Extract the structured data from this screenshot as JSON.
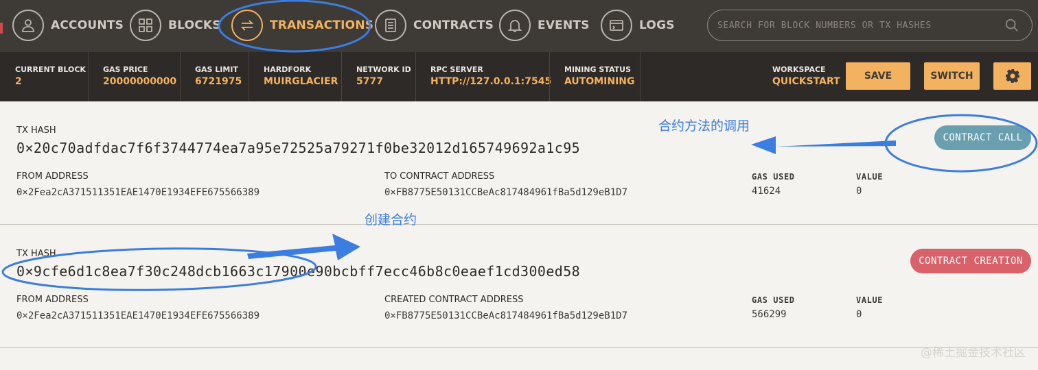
{
  "nav": {
    "items": [
      {
        "label": "ACCOUNTS",
        "icon": "user-icon"
      },
      {
        "label": "BLOCKS",
        "icon": "grid-icon"
      },
      {
        "label": "TRANSACTIONS",
        "icon": "swap-arrows-icon",
        "active": true
      },
      {
        "label": "CONTRACTS",
        "icon": "document-icon"
      },
      {
        "label": "EVENTS",
        "icon": "bell-icon"
      },
      {
        "label": "LOGS",
        "icon": "terminal-icon"
      }
    ],
    "search_placeholder": "SEARCH FOR BLOCK NUMBERS OR TX HASHES"
  },
  "status": {
    "current_block": {
      "label": "CURRENT BLOCK",
      "value": "2"
    },
    "gas_price": {
      "label": "GAS PRICE",
      "value": "20000000000"
    },
    "gas_limit": {
      "label": "GAS LIMIT",
      "value": "6721975"
    },
    "hardfork": {
      "label": "HARDFORK",
      "value": "MUIRGLACIER"
    },
    "network_id": {
      "label": "NETWORK ID",
      "value": "5777"
    },
    "rpc_server": {
      "label": "RPC SERVER",
      "value": "HTTP://127.0.0.1:7545"
    },
    "mining_status": {
      "label": "MINING STATUS",
      "value": "AUTOMINING"
    },
    "workspace": {
      "label": "WORKSPACE",
      "value": "QUICKSTART"
    },
    "save_label": "SAVE",
    "switch_label": "SWITCH"
  },
  "transactions": [
    {
      "hash_label": "TX HASH",
      "hash": "0×20c70adfdac7f6f3744774ea7a95e72525a79271f0be32012d165749692a1c95",
      "from_label": "FROM ADDRESS",
      "from": "0×2Fea2cA371511351EAE1470E1934EFE675566389",
      "to_label": "TO CONTRACT ADDRESS",
      "to": "0×FB8775E50131CCBeAc817484961fBa5d129eB1D7",
      "gas_label": "GAS USED",
      "gas": "41624",
      "value_label": "VALUE",
      "value": "0",
      "badge": "CONTRACT CALL"
    },
    {
      "hash_label": "TX HASH",
      "hash": "0×9cfe6d1c8ea7f30c248dcb1663c17900e90bcbff7ecc46b8c0eaef1cd300ed58",
      "from_label": "FROM ADDRESS",
      "from": "0×2Fea2cA371511351EAE1470E1934EFE675566389",
      "to_label": "CREATED CONTRACT ADDRESS",
      "to": "0×FB8775E50131CCBeAc817484961fBa5d129eB1D7",
      "gas_label": "GAS USED",
      "gas": "566299",
      "value_label": "VALUE",
      "value": "0",
      "badge": "CONTRACT CREATION"
    }
  ],
  "annotations": {
    "contract_call_note": "合约方法的调用",
    "create_contract_note": "创建合约"
  },
  "watermark": "@稀土掘金技术社区",
  "colors": {
    "nav_bg": "#3e3a36",
    "status_bg": "#2d2a27",
    "accent": "#f3b25f",
    "badge_call": "#6a9fb0",
    "badge_creation": "#d9616a",
    "annotation_blue": "#3b7de0"
  }
}
